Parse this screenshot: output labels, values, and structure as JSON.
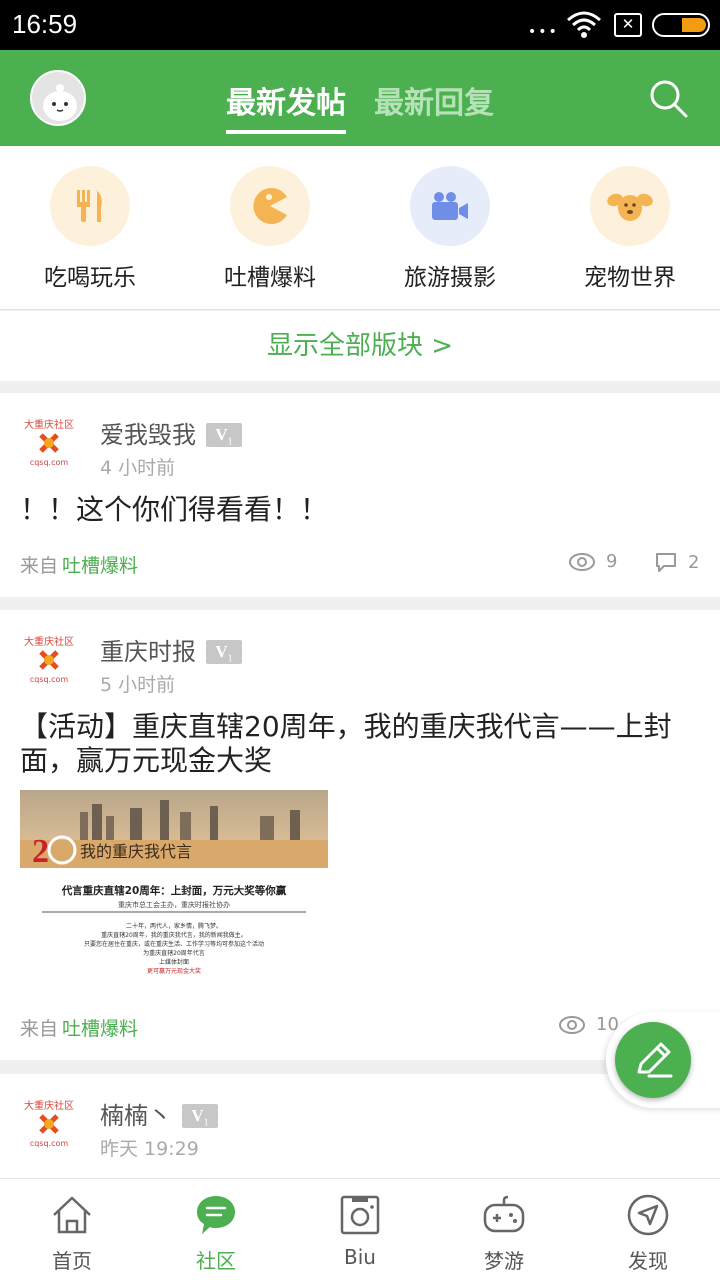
{
  "status_bar": {
    "time": "16:59",
    "dots": "•••"
  },
  "colors": {
    "brand": "#4caf50",
    "accent_text": "#4caf50",
    "tab_inactive": "#b5e2b7"
  },
  "header": {
    "tabs": [
      {
        "label": "最新发帖",
        "active": true
      },
      {
        "label": "最新回复",
        "active": false
      }
    ],
    "icons": {
      "avatar": "user-avatar",
      "search": "search-icon"
    }
  },
  "forums": [
    {
      "label": "吃喝玩乐",
      "icon": "fork-knife-icon",
      "bg": "#fdf1dc"
    },
    {
      "label": "吐槽爆料",
      "icon": "pacman-icon",
      "bg": "#fdf1dc"
    },
    {
      "label": "旅游摄影",
      "icon": "video-camera-icon",
      "bg": "#e6ecfa"
    },
    {
      "label": "宠物世界",
      "icon": "dog-icon",
      "bg": "#fdf1dc"
    }
  ],
  "show_all": "显示全部版块 >",
  "posts": [
    {
      "author": "爱我毁我",
      "level": "V",
      "level_num": "1",
      "time": "4 小时前",
      "title": "！！这个你们得看看！！",
      "from_label": "来自",
      "forum": "吐槽爆料",
      "views": "9",
      "comments": "2"
    },
    {
      "author": "重庆时报",
      "level": "V",
      "level_num": "1",
      "time": "5 小时前",
      "title": "【活动】重庆直辖20周年，我的重庆我代言——上封面，赢万元现金大奖",
      "from_label": "来自",
      "forum": "吐槽爆料",
      "views": "10",
      "image": {
        "banner_text": "我的重庆我代言",
        "headline": "代言重庆直辖20周年：上封面，万元大奖等你赢",
        "sub": "重庆市总工会主办，重庆时报社协办",
        "body": [
          "二十年，两代人，家乡情，腾飞梦。",
          "重庆直辖20周年，我的重庆我代言，我的新闻我做主。",
          "只要您在居住在重庆，或在重庆生活、工作学习等均可参加这个活动",
          "为重庆直辖20周年代言",
          "上媒体封面",
          "更可赢万元现金大奖"
        ]
      }
    },
    {
      "author": "楠楠丶",
      "level": "V",
      "level_num": "1",
      "time": "昨天 19:29"
    }
  ],
  "avatar_logo_text": {
    "top": "大重庆社区",
    "bottom": "cqsq.com"
  },
  "bottom_tabs": [
    {
      "label": "首页",
      "icon": "home-icon",
      "active": false
    },
    {
      "label": "社区",
      "icon": "chat-bubble-icon",
      "active": true
    },
    {
      "label": "Biu",
      "icon": "camera-icon",
      "active": false
    },
    {
      "label": "梦游",
      "icon": "gamepad-icon",
      "active": false
    },
    {
      "label": "发现",
      "icon": "compass-icon",
      "active": false
    }
  ],
  "fab_icon": "pencil-icon"
}
